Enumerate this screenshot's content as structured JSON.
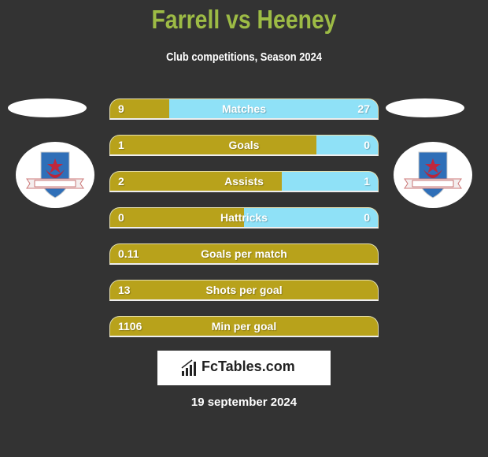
{
  "header": {
    "title": "Farrell vs Heeney",
    "subtitle": "Club competitions, Season 2024"
  },
  "players": {
    "left": {
      "name": "Farrell",
      "club_logo": "drogheda-united-crest"
    },
    "right": {
      "name": "Heeney",
      "club_logo": "drogheda-united-crest"
    }
  },
  "colors": {
    "title": "#9dbb45",
    "left_bar": "#b8a21b",
    "right_bar": "#8fe1f7",
    "background": "#333333"
  },
  "stats": [
    {
      "label": "Matches",
      "left": "9",
      "right": "27",
      "left_share": 0.22
    },
    {
      "label": "Goals",
      "left": "1",
      "right": "0",
      "left_share": 0.77
    },
    {
      "label": "Assists",
      "left": "2",
      "right": "1",
      "left_share": 0.64
    },
    {
      "label": "Hattricks",
      "left": "0",
      "right": "0",
      "left_share": 0.5
    },
    {
      "label": "Goals per match",
      "left": "0.11",
      "right": "",
      "left_share": 1.0
    },
    {
      "label": "Shots per goal",
      "left": "13",
      "right": "",
      "left_share": 1.0
    },
    {
      "label": "Min per goal",
      "left": "1106",
      "right": "",
      "left_share": 1.0
    }
  ],
  "brand": {
    "text": "FcTables.com",
    "icon": "bar-chart-icon"
  },
  "date": "19 september 2024"
}
